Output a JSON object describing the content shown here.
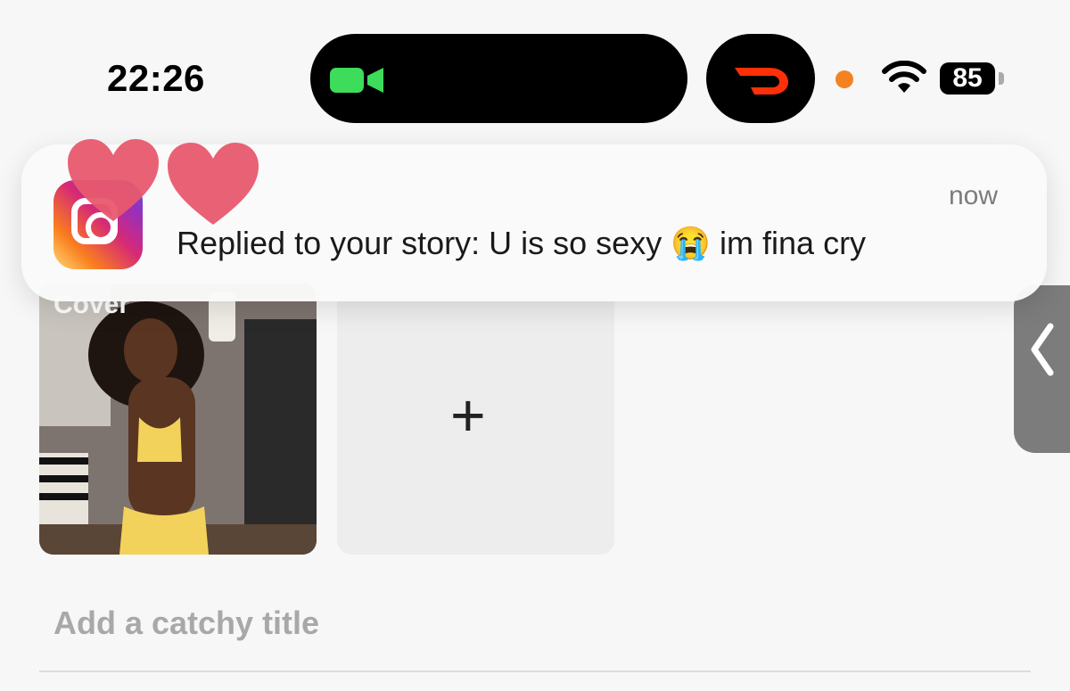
{
  "status_bar": {
    "time": "22:26",
    "battery": "85",
    "icons": [
      "video-camera-icon",
      "doordash-icon",
      "recording-dot-icon",
      "wifi-icon",
      "battery-icon"
    ]
  },
  "notification": {
    "app": "Instagram",
    "timestamp": "now",
    "message": "Replied to your story: U is so sexy 😭 im fina cry"
  },
  "story_editor": {
    "cover_label": "Cover",
    "add_button_symbol": "+",
    "title_placeholder": "Add a catchy title"
  },
  "colors": {
    "facetime_green": "#3ddc5a",
    "doordash_red": "#ff3008",
    "record_dot": "#f58220",
    "heart_pink": "#e8596e"
  }
}
